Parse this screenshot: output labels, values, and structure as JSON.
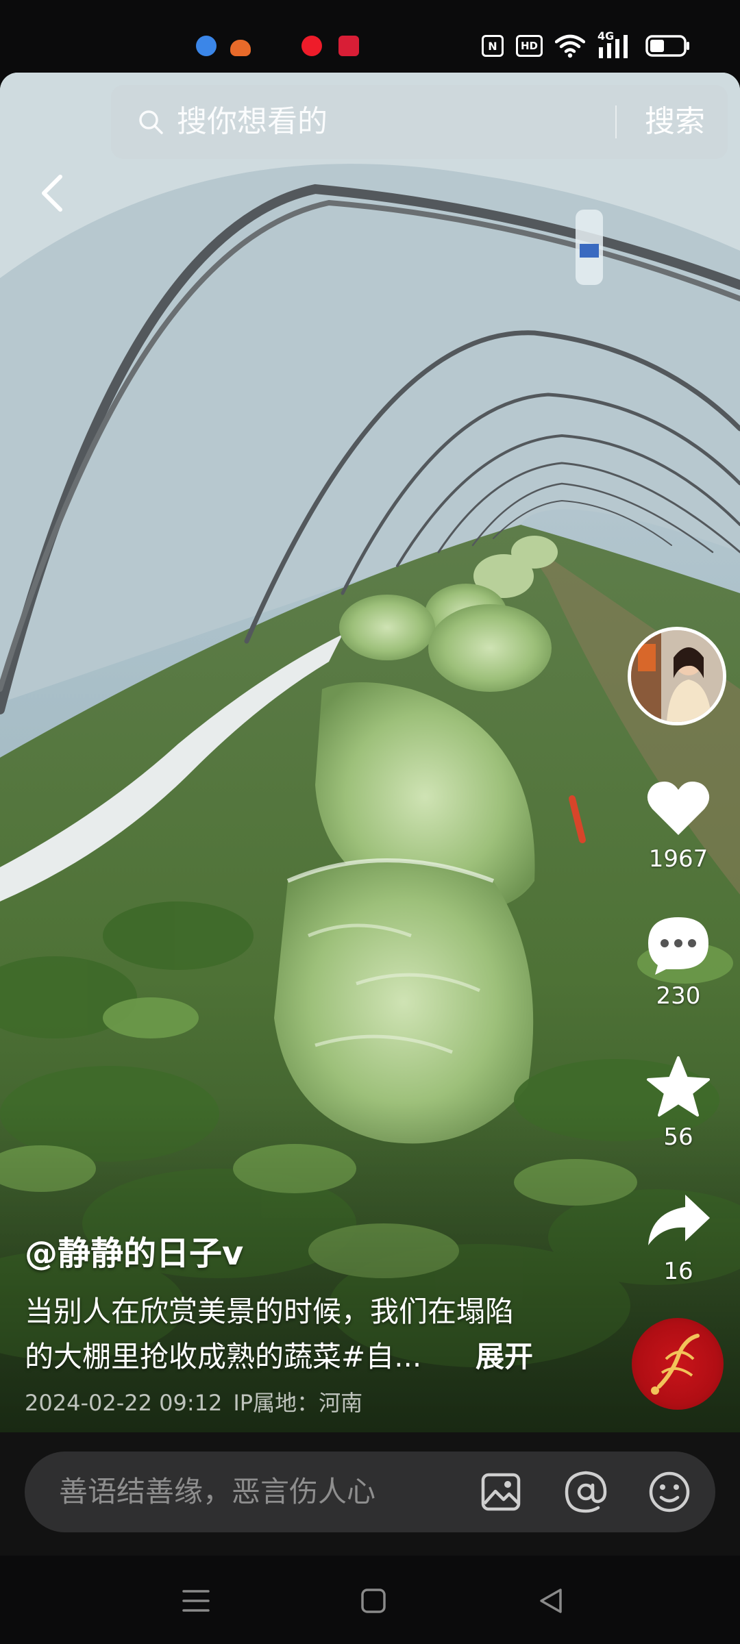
{
  "status_bar": {
    "nfc_label": "N",
    "hd_label": "HD",
    "network_label": "4G",
    "notification_icons": [
      "app-blue-icon",
      "app-orange-icon",
      "app-red-icon",
      "app-red-video-icon"
    ],
    "icons": [
      "nfc-icon",
      "hd-voice-icon",
      "wifi-icon",
      "cellular-signal-icon",
      "battery-icon"
    ]
  },
  "search": {
    "placeholder": "搜你想看的",
    "button_label": "搜索"
  },
  "rail": {
    "like_count": "1967",
    "comment_count": "230",
    "favorite_count": "56",
    "share_count": "16"
  },
  "post": {
    "author": "@静静的日子v",
    "caption_lines": [
      "当别人在欣赏美景的时候，我们在塌陷",
      "的大棚里抢收成熟的蔬菜#自..."
    ],
    "expand_label": "展开",
    "datetime": "2024-02-22 09:12",
    "ip_location": "IP属地：河南"
  },
  "comment_bar": {
    "placeholder": "善语结善缘，恶言伤人心",
    "icons": [
      "image-icon",
      "mention-icon",
      "emoji-icon"
    ]
  },
  "nav": {
    "icons": [
      "menu-icon",
      "home-square-icon",
      "back-triangle-icon"
    ]
  },
  "colors": {
    "background": "#0b0b0c",
    "comment_box": "#2f2f30",
    "placeholder": "#8e8e8e",
    "music_disc": "#c8141a"
  }
}
